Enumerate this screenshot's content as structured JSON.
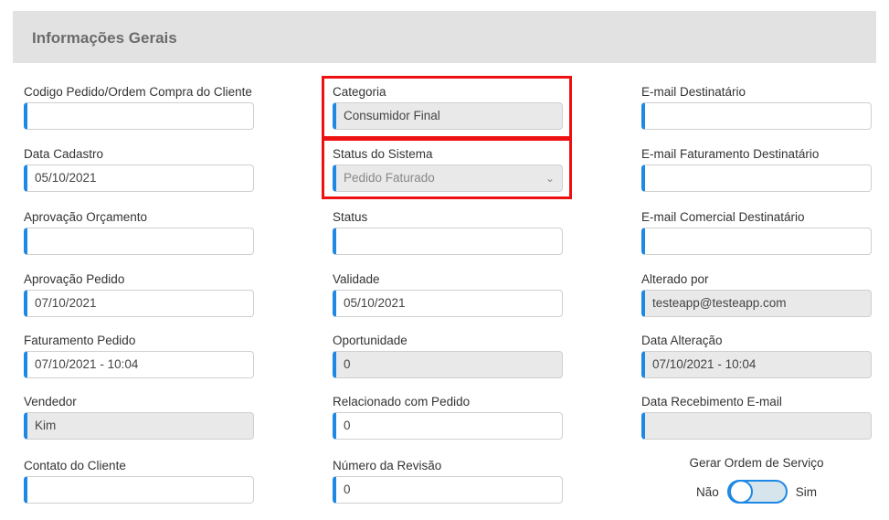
{
  "section": {
    "title": "Informações Gerais"
  },
  "col1": [
    {
      "label": "Codigo Pedido/Ordem Compra do Cliente",
      "value": ""
    },
    {
      "label": "Data Cadastro",
      "value": "05/10/2021"
    },
    {
      "label": "Aprovação Orçamento",
      "value": ""
    },
    {
      "label": "Aprovação Pedido",
      "value": "07/10/2021"
    },
    {
      "label": "Faturamento Pedido",
      "value": "07/10/2021 - 10:04"
    },
    {
      "label": "Vendedor",
      "value": "Kim"
    },
    {
      "label": "Contato do Cliente",
      "value": ""
    }
  ],
  "col2": [
    {
      "label": "Categoria",
      "value": "Consumidor Final"
    },
    {
      "label": "Status do Sistema",
      "value": "Pedido Faturado"
    },
    {
      "label": "Status",
      "value": ""
    },
    {
      "label": "Validade",
      "value": "05/10/2021"
    },
    {
      "label": "Oportunidade",
      "value": "0"
    },
    {
      "label": "Relacionado com Pedido",
      "value": "0"
    },
    {
      "label": "Número da Revisão",
      "value": "0"
    }
  ],
  "col3": [
    {
      "label": "E-mail Destinatário",
      "value": ""
    },
    {
      "label": "E-mail Faturamento Destinatário",
      "value": ""
    },
    {
      "label": "E-mail Comercial Destinatário",
      "value": ""
    },
    {
      "label": "Alterado por",
      "value": "testeapp@testeapp.com"
    },
    {
      "label": "Data Alteração",
      "value": "07/10/2021 - 10:04"
    },
    {
      "label": "Data Recebimento E-mail",
      "value": ""
    }
  ],
  "toggle": {
    "label": "Gerar Ordem de Serviço",
    "off_label": "Não",
    "on_label": "Sim"
  },
  "colors": {
    "accent": "#1e88e5",
    "highlight": "#e11111",
    "disabled_bg": "#e9e9e9",
    "header_bg": "#e2e2e2"
  }
}
